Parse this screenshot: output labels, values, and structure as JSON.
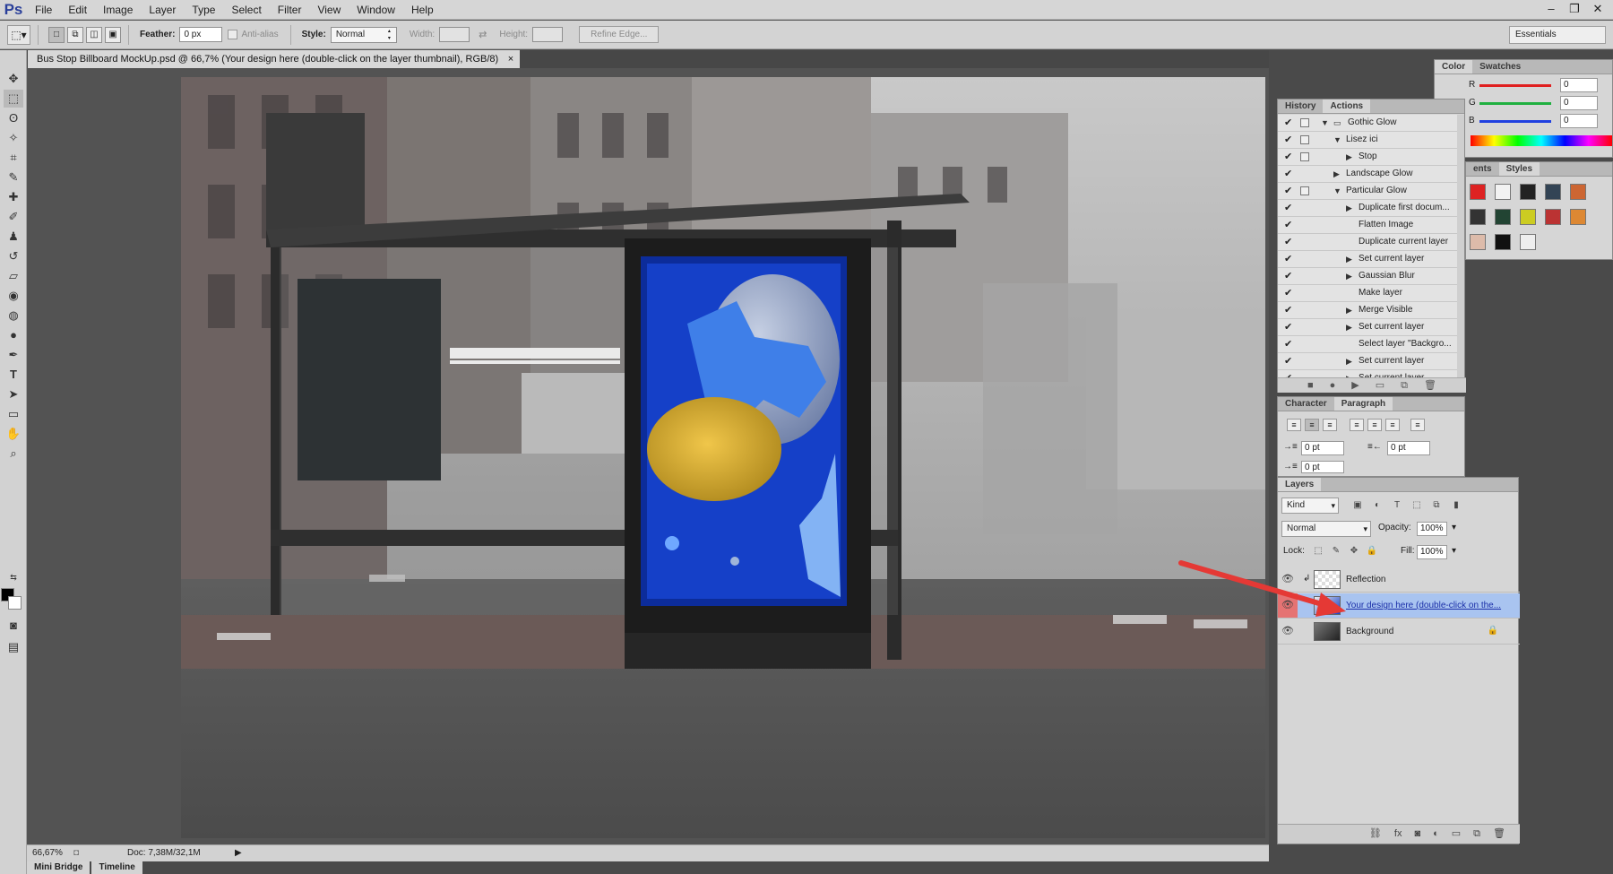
{
  "app": {
    "logo": "Ps"
  },
  "menu": [
    "File",
    "Edit",
    "Image",
    "Layer",
    "Type",
    "Select",
    "Filter",
    "View",
    "Window",
    "Help"
  ],
  "window_controls": {
    "minimize": "–",
    "restore": "❐",
    "close": "✕"
  },
  "options": {
    "feather_label": "Feather:",
    "feather_value": "0 px",
    "antialias_label": "Anti-alias",
    "style_label": "Style:",
    "style_value": "Normal",
    "width_label": "Width:",
    "height_label": "Height:",
    "refine_label": "Refine Edge...",
    "workspace": "Essentials"
  },
  "document": {
    "tab_title": "Bus Stop Billboard MockUp.psd @ 66,7% (Your design here (double-click on the layer thumbnail), RGB/8)",
    "close": "×",
    "zoom": "66,67%",
    "doc_info": "Doc: 7,38M/32,1M"
  },
  "bottom_tabs": [
    "Mini Bridge",
    "Timeline"
  ],
  "color_panel": {
    "tabs": [
      "Color",
      "Swatches"
    ],
    "channels": [
      {
        "label": "R",
        "value": "0"
      },
      {
        "label": "G",
        "value": "0"
      },
      {
        "label": "B",
        "value": "0"
      }
    ]
  },
  "styles_panel": {
    "tabs": [
      "ents",
      "Styles"
    ]
  },
  "actions_panel": {
    "tabs": [
      "History",
      "Actions"
    ],
    "rows": [
      {
        "label": "Gothic Glow",
        "level": 0,
        "arrow": "▼",
        "box": true,
        "folder": true
      },
      {
        "label": "Lisez ici",
        "level": 1,
        "arrow": "▼",
        "box": true
      },
      {
        "label": "Stop",
        "level": 2,
        "arrow": "▶",
        "box": true
      },
      {
        "label": "Landscape Glow",
        "level": 1,
        "arrow": "▶",
        "box": false
      },
      {
        "label": "Particular Glow",
        "level": 1,
        "arrow": "▼",
        "box": true
      },
      {
        "label": "Duplicate first docum...",
        "level": 2,
        "arrow": "▶",
        "box": false
      },
      {
        "label": "Flatten Image",
        "level": 2,
        "arrow": "",
        "box": false
      },
      {
        "label": "Duplicate current layer",
        "level": 2,
        "arrow": "",
        "box": false
      },
      {
        "label": "Set current layer",
        "level": 2,
        "arrow": "▶",
        "box": false
      },
      {
        "label": "Gaussian Blur",
        "level": 2,
        "arrow": "▶",
        "box": false
      },
      {
        "label": "Make layer",
        "level": 2,
        "arrow": "",
        "box": false
      },
      {
        "label": "Merge Visible",
        "level": 2,
        "arrow": "▶",
        "box": false
      },
      {
        "label": "Set current layer",
        "level": 2,
        "arrow": "▶",
        "box": false
      },
      {
        "label": "Select layer \"Backgro...",
        "level": 2,
        "arrow": "",
        "box": false
      },
      {
        "label": "Set current layer",
        "level": 2,
        "arrow": "▶",
        "box": false
      },
      {
        "label": "Set current layer",
        "level": 2,
        "arrow": "▶",
        "box": false
      }
    ]
  },
  "paragraph_panel": {
    "tabs": [
      "Character",
      "Paragraph"
    ],
    "indent_left": "0 pt",
    "indent_right": "0 pt",
    "indent_first": "0 pt"
  },
  "layers_panel": {
    "title": "Layers",
    "filter": "Kind",
    "blend_mode": "Normal",
    "opacity_label": "Opacity:",
    "opacity": "100%",
    "lock_label": "Lock:",
    "fill_label": "Fill:",
    "fill": "100%",
    "layers": [
      {
        "name": "Reflection",
        "selected": false
      },
      {
        "name": "Your design here (double-click on the...",
        "selected": true
      },
      {
        "name": "Background",
        "selected": false
      }
    ]
  },
  "colors": {
    "accent_arrow": "#e53935",
    "selected_layer": "#a9c4f0",
    "poster_blue": "#1540c8"
  }
}
